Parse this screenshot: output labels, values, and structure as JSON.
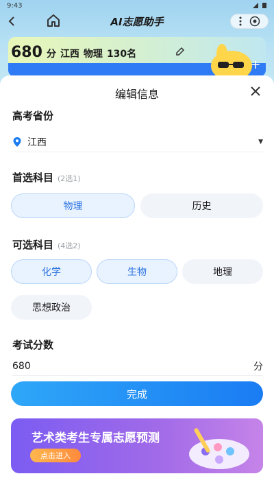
{
  "status_bar": {
    "time": "9:43"
  },
  "nav": {
    "title": "AI志愿助手"
  },
  "score_card": {
    "score": "680",
    "unit": "分",
    "province": "江西",
    "subject": "物理",
    "rank": "130名"
  },
  "sheet": {
    "title": "编辑信息",
    "province_section": {
      "title": "高考省份",
      "value": "江西"
    },
    "required_section": {
      "title": "首选科目",
      "hint": "(2选1)",
      "options": [
        {
          "label": "物理",
          "selected": true
        },
        {
          "label": "历史",
          "selected": false
        }
      ]
    },
    "optional_section": {
      "title": "可选科目",
      "hint": "(4选2)",
      "options": [
        {
          "label": "化学",
          "selected": true
        },
        {
          "label": "生物",
          "selected": true
        },
        {
          "label": "地理",
          "selected": false
        },
        {
          "label": "思想政治",
          "selected": false
        }
      ]
    },
    "score_section": {
      "title": "考试分数",
      "value": "680",
      "unit": "分"
    },
    "done_label": "完成",
    "banner": {
      "title": "艺术类考生专属志愿预测",
      "button_label": "点击进入"
    }
  },
  "colors": {
    "accent_blue": "#1a7cf3",
    "chip_selected_text": "#2d73e0",
    "banner_purple": "#7b5cf2",
    "banner_button": "#ff8a3d"
  }
}
